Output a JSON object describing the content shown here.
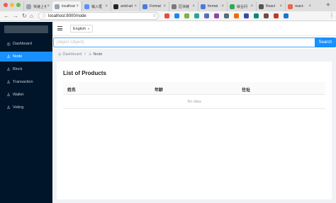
{
  "browser": {
    "tabs": [
      {
        "title": "快速上手",
        "icon": "doc-icon",
        "color": "#9aa4ad",
        "active": false
      },
      {
        "title": "localhost",
        "icon": "page-icon",
        "color": "#9aa4ad",
        "active": true
      },
      {
        "title": "输入框",
        "icon": "diamond-icon",
        "color": "#5b8ff9",
        "active": false
      },
      {
        "title": "antd-ad",
        "icon": "github-icon",
        "color": "#222222",
        "active": false
      },
      {
        "title": "Format",
        "icon": "star-icon",
        "color": "#4b7bd8",
        "active": false
      },
      {
        "title": "区块链",
        "icon": "chain-icon",
        "color": "#7a7a7a",
        "active": false
      },
      {
        "title": "format",
        "icon": "star-icon",
        "color": "#4b7bd8",
        "active": false
      },
      {
        "title": "就业问",
        "icon": "sheet-icon",
        "color": "#34a853",
        "active": false
      },
      {
        "title": "React",
        "icon": "search-icon",
        "color": "#555555",
        "active": false
      },
      {
        "title": "react-",
        "icon": "react-icon",
        "color": "#e8684a",
        "active": false
      }
    ],
    "url": "localhost:8000/node",
    "extension_colors": [
      "#e84c3d",
      "#1e88e5",
      "#7cb342",
      "#26a69a",
      "#5c6bc0",
      "#8e44ad",
      "#546e7a",
      "#ef6c00",
      "#3949ab",
      "#00897b",
      "#6d4c41",
      "#c0392b",
      "#1976d2"
    ]
  },
  "sidebar": {
    "items": [
      {
        "label": "Dashboard",
        "icon": "dashboard-icon",
        "glyph": "◎",
        "active": false
      },
      {
        "label": "Node",
        "icon": "user-icon",
        "glyph": "♙",
        "active": true
      },
      {
        "label": "Block",
        "icon": "user-icon",
        "glyph": "♙",
        "active": false
      },
      {
        "label": "Transaction",
        "icon": "user-icon",
        "glyph": "♙",
        "active": false
      },
      {
        "label": "Wallet",
        "icon": "user-icon",
        "glyph": "♙",
        "active": false
      },
      {
        "label": "Voting",
        "icon": "user-icon",
        "glyph": "♙",
        "active": false
      }
    ]
  },
  "header": {
    "language": "English"
  },
  "search": {
    "placeholder": "[object Object]",
    "button_label": "Search"
  },
  "breadcrumb": {
    "home": "Dashboard",
    "separator": "/",
    "current": "Node"
  },
  "card": {
    "title": "List of Products",
    "columns": [
      "姓名",
      "年龄",
      "住址"
    ],
    "empty_text": "No data"
  },
  "colors": {
    "primary": "#1890ff",
    "sidebar_bg": "#001529",
    "content_bg": "#f0f2f5"
  }
}
